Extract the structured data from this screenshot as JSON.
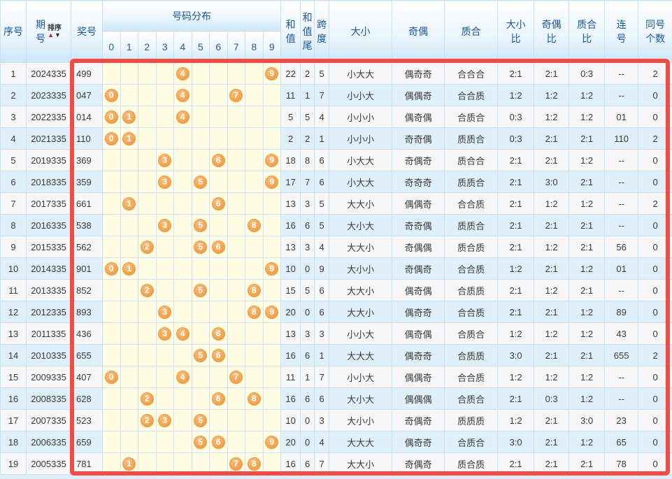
{
  "header": {
    "seq": "序号",
    "period_lines": [
      "期",
      "号"
    ],
    "sort_label": "排序",
    "sort_up_icon": "▲",
    "sort_down_icon": "▼",
    "number": "奖号",
    "distribution": "号码分布",
    "digits": [
      "0",
      "1",
      "2",
      "3",
      "4",
      "5",
      "6",
      "7",
      "8",
      "9"
    ],
    "sum_lines": [
      "和",
      "值"
    ],
    "sum_tail_lines": [
      "和",
      "值",
      "尾"
    ],
    "span_lines": [
      "跨",
      "度"
    ],
    "size": "大小",
    "parity": "奇偶",
    "prime": "质合",
    "size_ratio_lines": [
      "大小",
      "比"
    ],
    "parity_ratio_lines": [
      "奇偶",
      "比"
    ],
    "prime_ratio_lines": [
      "质合",
      "比"
    ],
    "consec_lines": [
      "连",
      "号"
    ],
    "same_lines": [
      "同号",
      "个数"
    ]
  },
  "colors": {
    "frame_red": "#f24b43",
    "ball_orange": "#ef9638",
    "cell_yellow": "#fffde4",
    "row_even_blue": "#e0f0fb",
    "row_odd_gray": "#f7f7f7",
    "header_blue_text": "#1d57a6",
    "grid_line": "#c7e0f2"
  },
  "rows": [
    {
      "seq": "1",
      "period": "2024335",
      "number": "499",
      "digits": [
        4,
        9
      ],
      "sum": "22",
      "tail": "2",
      "span": "5",
      "size": "小大大",
      "parity": "偶奇奇",
      "prime": "合合合",
      "size_ratio": "2:1",
      "parity_ratio": "2:1",
      "prime_ratio": "0:3",
      "consec": "--",
      "same": "2"
    },
    {
      "seq": "2",
      "period": "2023335",
      "number": "047",
      "digits": [
        0,
        4,
        7
      ],
      "sum": "11",
      "tail": "1",
      "span": "7",
      "size": "小小大",
      "parity": "偶偶奇",
      "prime": "合合质",
      "size_ratio": "1:2",
      "parity_ratio": "1:2",
      "prime_ratio": "1:2",
      "consec": "--",
      "same": "0"
    },
    {
      "seq": "3",
      "period": "2022335",
      "number": "014",
      "digits": [
        0,
        1,
        4
      ],
      "sum": "5",
      "tail": "5",
      "span": "4",
      "size": "小小小",
      "parity": "偶奇偶",
      "prime": "合质合",
      "size_ratio": "0:3",
      "parity_ratio": "1:2",
      "prime_ratio": "1:2",
      "consec": "01",
      "same": "0"
    },
    {
      "seq": "4",
      "period": "2021335",
      "number": "110",
      "digits": [
        0,
        1
      ],
      "sum": "2",
      "tail": "2",
      "span": "1",
      "size": "小小小",
      "parity": "奇奇偶",
      "prime": "质质合",
      "size_ratio": "0:3",
      "parity_ratio": "2:1",
      "prime_ratio": "2:1",
      "consec": "110",
      "same": "2"
    },
    {
      "seq": "5",
      "period": "2019335",
      "number": "369",
      "digits": [
        3,
        6,
        9
      ],
      "sum": "18",
      "tail": "8",
      "span": "6",
      "size": "小大大",
      "parity": "奇偶奇",
      "prime": "质合合",
      "size_ratio": "2:1",
      "parity_ratio": "2:1",
      "prime_ratio": "1:2",
      "consec": "--",
      "same": "0"
    },
    {
      "seq": "6",
      "period": "2018335",
      "number": "359",
      "digits": [
        3,
        5,
        9
      ],
      "sum": "17",
      "tail": "7",
      "span": "6",
      "size": "小大大",
      "parity": "奇奇奇",
      "prime": "质质合",
      "size_ratio": "2:1",
      "parity_ratio": "3:0",
      "prime_ratio": "2:1",
      "consec": "--",
      "same": "0"
    },
    {
      "seq": "7",
      "period": "2017335",
      "number": "661",
      "digits": [
        1,
        6
      ],
      "sum": "13",
      "tail": "3",
      "span": "5",
      "size": "大大小",
      "parity": "偶偶奇",
      "prime": "合合质",
      "size_ratio": "2:1",
      "parity_ratio": "1:2",
      "prime_ratio": "1:2",
      "consec": "--",
      "same": "2"
    },
    {
      "seq": "8",
      "period": "2016335",
      "number": "538",
      "digits": [
        3,
        5,
        8
      ],
      "sum": "16",
      "tail": "6",
      "span": "5",
      "size": "大小大",
      "parity": "奇奇偶",
      "prime": "质质合",
      "size_ratio": "2:1",
      "parity_ratio": "2:1",
      "prime_ratio": "2:1",
      "consec": "--",
      "same": "0"
    },
    {
      "seq": "9",
      "period": "2015335",
      "number": "562",
      "digits": [
        2,
        5,
        6
      ],
      "sum": "13",
      "tail": "3",
      "span": "4",
      "size": "大大小",
      "parity": "奇偶偶",
      "prime": "质合质",
      "size_ratio": "2:1",
      "parity_ratio": "1:2",
      "prime_ratio": "2:1",
      "consec": "56",
      "same": "0"
    },
    {
      "seq": "10",
      "period": "2014335",
      "number": "901",
      "digits": [
        0,
        1,
        9
      ],
      "sum": "10",
      "tail": "0",
      "span": "9",
      "size": "大小小",
      "parity": "奇偶奇",
      "prime": "合合质",
      "size_ratio": "1:2",
      "parity_ratio": "2:1",
      "prime_ratio": "1:2",
      "consec": "01",
      "same": "0"
    },
    {
      "seq": "11",
      "period": "2013335",
      "number": "852",
      "digits": [
        2,
        5,
        8
      ],
      "sum": "15",
      "tail": "5",
      "span": "6",
      "size": "大大小",
      "parity": "偶奇偶",
      "prime": "合质质",
      "size_ratio": "2:1",
      "parity_ratio": "1:2",
      "prime_ratio": "2:1",
      "consec": "--",
      "same": "0"
    },
    {
      "seq": "12",
      "period": "2012335",
      "number": "893",
      "digits": [
        3,
        8,
        9
      ],
      "sum": "20",
      "tail": "0",
      "span": "6",
      "size": "大大小",
      "parity": "偶奇奇",
      "prime": "合合质",
      "size_ratio": "2:1",
      "parity_ratio": "2:1",
      "prime_ratio": "1:2",
      "consec": "89",
      "same": "0"
    },
    {
      "seq": "13",
      "period": "2011335",
      "number": "436",
      "digits": [
        3,
        4,
        6
      ],
      "sum": "13",
      "tail": "3",
      "span": "3",
      "size": "小小大",
      "parity": "偶奇偶",
      "prime": "合质合",
      "size_ratio": "1:2",
      "parity_ratio": "1:2",
      "prime_ratio": "1:2",
      "consec": "43",
      "same": "0"
    },
    {
      "seq": "14",
      "period": "2010335",
      "number": "655",
      "digits": [
        5,
        6
      ],
      "sum": "16",
      "tail": "6",
      "span": "1",
      "size": "大大大",
      "parity": "偶奇奇",
      "prime": "合质质",
      "size_ratio": "3:0",
      "parity_ratio": "2:1",
      "prime_ratio": "2:1",
      "consec": "655",
      "same": "2"
    },
    {
      "seq": "15",
      "period": "2009335",
      "number": "407",
      "digits": [
        0,
        4,
        7
      ],
      "sum": "11",
      "tail": "1",
      "span": "7",
      "size": "小小大",
      "parity": "偶偶奇",
      "prime": "合合质",
      "size_ratio": "1:2",
      "parity_ratio": "1:2",
      "prime_ratio": "1:2",
      "consec": "--",
      "same": "0"
    },
    {
      "seq": "16",
      "period": "2008335",
      "number": "628",
      "digits": [
        2,
        6,
        8
      ],
      "sum": "16",
      "tail": "6",
      "span": "6",
      "size": "大小大",
      "parity": "偶偶偶",
      "prime": "合质合",
      "size_ratio": "2:1",
      "parity_ratio": "0:3",
      "prime_ratio": "1:2",
      "consec": "--",
      "same": "0"
    },
    {
      "seq": "17",
      "period": "2007335",
      "number": "523",
      "digits": [
        2,
        3,
        5
      ],
      "sum": "10",
      "tail": "0",
      "span": "3",
      "size": "大小小",
      "parity": "奇偶奇",
      "prime": "质质质",
      "size_ratio": "1:2",
      "parity_ratio": "2:1",
      "prime_ratio": "3:0",
      "consec": "23",
      "same": "0"
    },
    {
      "seq": "18",
      "period": "2006335",
      "number": "659",
      "digits": [
        5,
        6,
        9
      ],
      "sum": "20",
      "tail": "0",
      "span": "4",
      "size": "大大大",
      "parity": "偶奇奇",
      "prime": "合质合",
      "size_ratio": "3:0",
      "parity_ratio": "2:1",
      "prime_ratio": "1:2",
      "consec": "65",
      "same": "0"
    },
    {
      "seq": "19",
      "period": "2005335",
      "number": "781",
      "digits": [
        1,
        7,
        8
      ],
      "sum": "16",
      "tail": "6",
      "span": "7",
      "size": "大大小",
      "parity": "奇偶奇",
      "prime": "质合质",
      "size_ratio": "2:1",
      "parity_ratio": "2:1",
      "prime_ratio": "2:1",
      "consec": "78",
      "same": "0"
    }
  ]
}
